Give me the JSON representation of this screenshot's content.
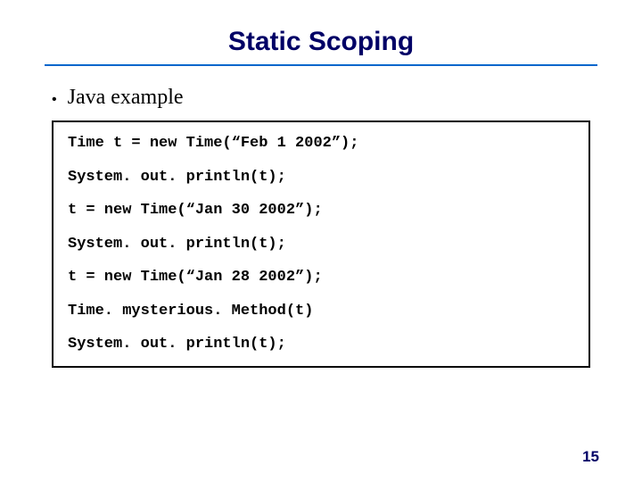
{
  "title": "Static Scoping",
  "bullet": "Java example",
  "code_lines": [
    "Time t = new Time(“Feb 1 2002”);",
    "System. out. println(t);",
    "t = new Time(“Jan 30 2002”);",
    "System. out. println(t);",
    "t = new Time(“Jan 28 2002”);",
    "Time. mysterious. Method(t)",
    "System. out. println(t);"
  ],
  "page_number": "15"
}
